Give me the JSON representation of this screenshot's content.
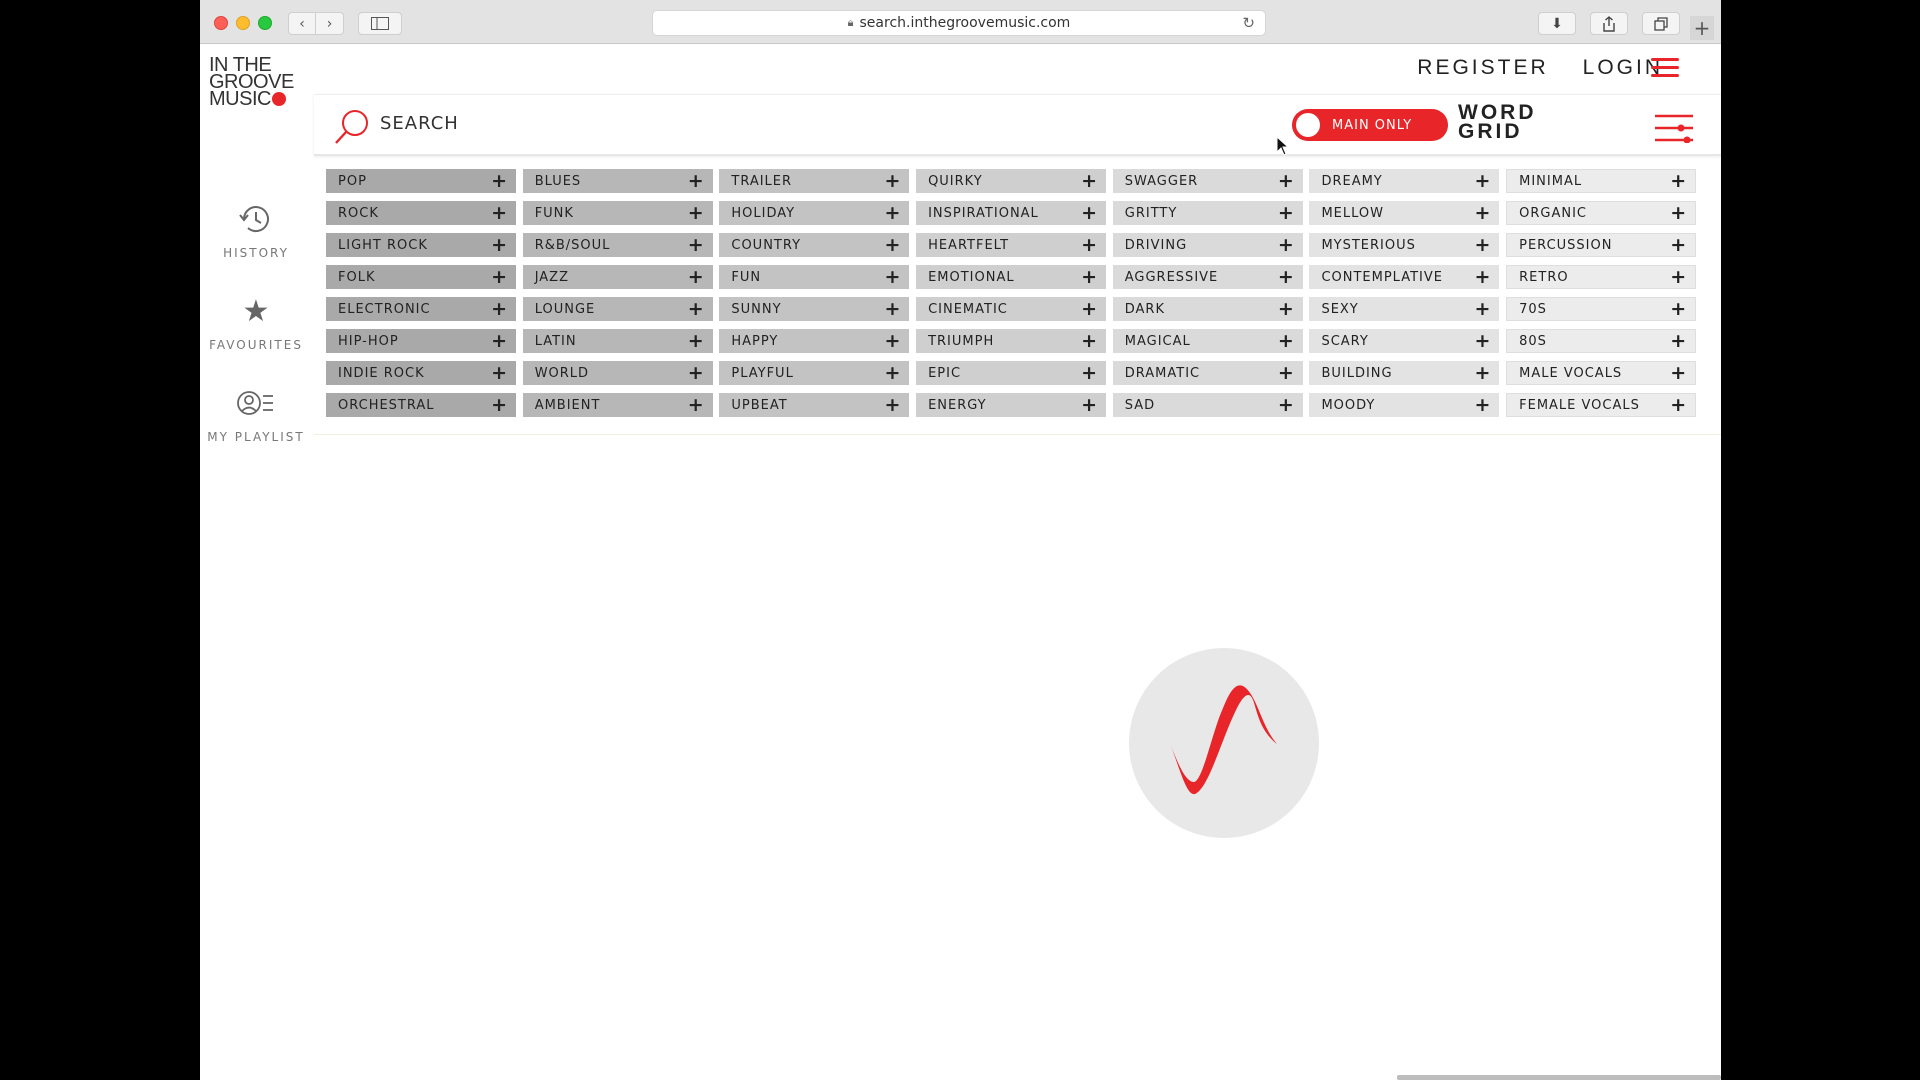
{
  "browser": {
    "url": "search.inthegroovemusic.com"
  },
  "logo": {
    "line1": "IN THE",
    "line2": "GROOVE",
    "line3": "MUSIC"
  },
  "top_nav": {
    "register": "REGISTER",
    "login": "LOGIN"
  },
  "left_nav": [
    {
      "label": "HISTORY",
      "icon": "history-icon"
    },
    {
      "label": "FAVOURITES",
      "icon": "star-icon"
    },
    {
      "label": "MY PLAYLIST",
      "icon": "playlist-icon"
    }
  ],
  "search": {
    "label": "SEARCH",
    "toggle_label": "MAIN ONLY",
    "word_grid_line1": "WORD",
    "word_grid_line2": "GRID"
  },
  "colors": {
    "accent": "#e8262a"
  },
  "tag_grid": {
    "columns": [
      [
        "POP",
        "ROCK",
        "LIGHT ROCK",
        "FOLK",
        "ELECTRONIC",
        "HIP-HOP",
        "INDIE ROCK",
        "ORCHESTRAL"
      ],
      [
        "BLUES",
        "FUNK",
        "R&B/SOUL",
        "JAZZ",
        "LOUNGE",
        "LATIN",
        "WORLD",
        "AMBIENT"
      ],
      [
        "TRAILER",
        "HOLIDAY",
        "COUNTRY",
        "FUN",
        "SUNNY",
        "HAPPY",
        "PLAYFUL",
        "UPBEAT"
      ],
      [
        "QUIRKY",
        "INSPIRATIONAL",
        "HEARTFELT",
        "EMOTIONAL",
        "CINEMATIC",
        "TRIUMPH",
        "EPIC",
        "ENERGY"
      ],
      [
        "SWAGGER",
        "GRITTY",
        "DRIVING",
        "AGGRESSIVE",
        "DARK",
        "MAGICAL",
        "DRAMATIC",
        "SAD"
      ],
      [
        "DREAMY",
        "MELLOW",
        "MYSTERIOUS",
        "CONTEMPLATIVE",
        "SEXY",
        "SCARY",
        "BUILDING",
        "MOODY"
      ],
      [
        "MINIMAL",
        "ORGANIC",
        "PERCUSSION",
        "RETRO",
        "70S",
        "80S",
        "MALE VOCALS",
        "FEMALE VOCALS"
      ]
    ],
    "plus_symbol": "+"
  }
}
